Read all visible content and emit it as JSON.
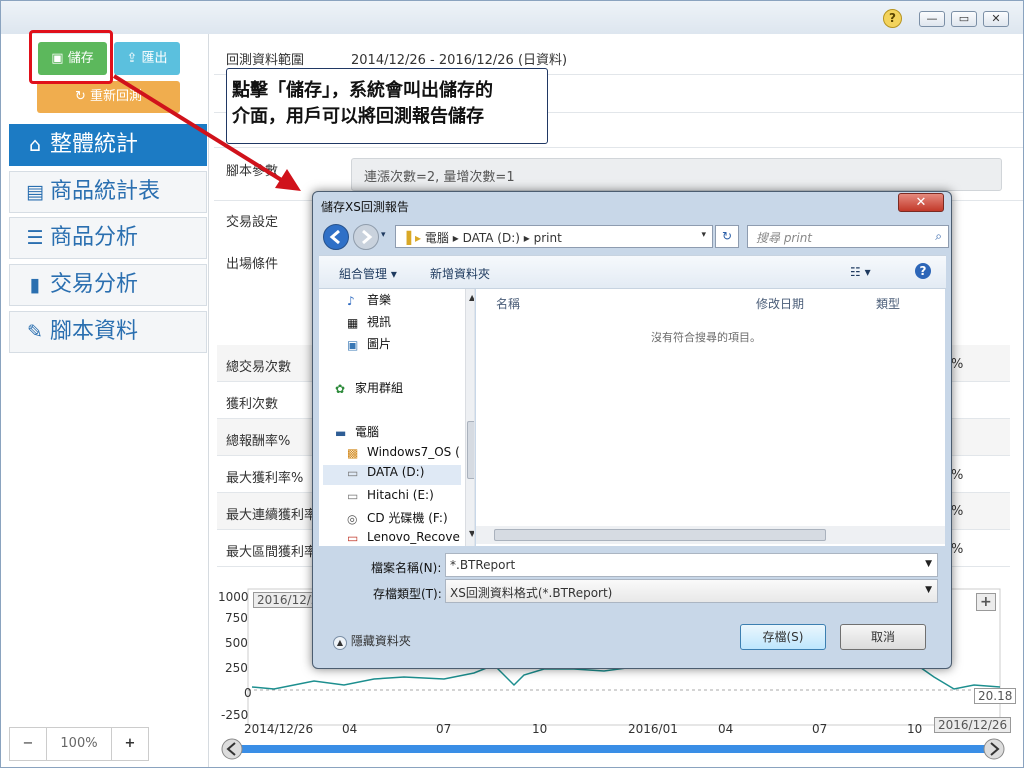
{
  "window": {
    "help_glyph": "?",
    "minimize_glyph": "—",
    "maximize_glyph": "▭",
    "close_glyph": "✕"
  },
  "sidebar": {
    "save_label": "儲存",
    "export_label": "匯出",
    "rerun_label": "重新回測",
    "nav": [
      {
        "label": "整體統計",
        "icon": "home-icon",
        "glyph": "⌂",
        "active": true
      },
      {
        "label": "商品統計表",
        "icon": "table-icon",
        "glyph": "▤"
      },
      {
        "label": "商品分析",
        "icon": "list-icon",
        "glyph": "☰"
      },
      {
        "label": "交易分析",
        "icon": "bar-chart-icon",
        "glyph": "▮"
      },
      {
        "label": "腳本資料",
        "icon": "pencil-icon",
        "glyph": "✎"
      }
    ],
    "zoom": {
      "minus": "−",
      "value": "100%",
      "plus": "+"
    }
  },
  "main": {
    "range_label": "回測資料範圍",
    "range_value": "2014/12/26 - 2016/12/26 (日資料)",
    "script_params_label": "腳本參數",
    "script_params_value": "連漲次數=2, 量增次數=1",
    "trade_settings_label": "交易設定",
    "exit_label": "出場條件",
    "stats": [
      "總交易次數",
      "獲利次數",
      "總報酬率%",
      "最大獲利率%",
      "最大連續獲利率%",
      "最大區間獲利率%"
    ],
    "pct_marks": [
      "%",
      "%",
      "%",
      "%",
      "%"
    ]
  },
  "chart_data": {
    "type": "line",
    "y_ticks": [
      "1000",
      "750",
      "500",
      "250",
      "0",
      "-250"
    ],
    "x_ticks": [
      "2014/12/26",
      "04",
      "07",
      "10",
      "2016/01",
      "04",
      "07",
      "10"
    ],
    "start_label": "2016/12/2",
    "end_value_label": "20.18",
    "end_date_label": "2016/12/26",
    "plus_label": "+"
  },
  "callout": {
    "text_line1": "點擊「儲存」，系統會叫出儲存的",
    "text_line2": "介面，用戶可以將回測報告儲存"
  },
  "dialog": {
    "title": "儲存XS回測報告",
    "close": "✕",
    "path": [
      "電腦",
      "DATA (D:)",
      "print"
    ],
    "search_placeholder": "搜尋 print",
    "organize": "組合管理 ▾",
    "new_folder": "新增資料夾",
    "view_glyph": "☷ ▾",
    "help_glyph": "?",
    "tree": [
      "音樂",
      "視訊",
      "圖片",
      "家用群組",
      "電腦",
      "Windows7_OS (",
      "DATA (D:)",
      "Hitachi (E:)",
      "CD 光碟機 (F:)",
      "Lenovo_Recove"
    ],
    "columns": [
      "名稱",
      "修改日期",
      "類型"
    ],
    "empty_message": "沒有符合搜尋的項目。",
    "filename_label": "檔案名稱(N):",
    "filename_value": "*.BTReport",
    "filetype_label": "存檔類型(T):",
    "filetype_value": "XS回測資料格式(*.BTReport)",
    "hide_folders": "隱藏資料夾",
    "save_button": "存檔(S)",
    "cancel_button": "取消"
  }
}
